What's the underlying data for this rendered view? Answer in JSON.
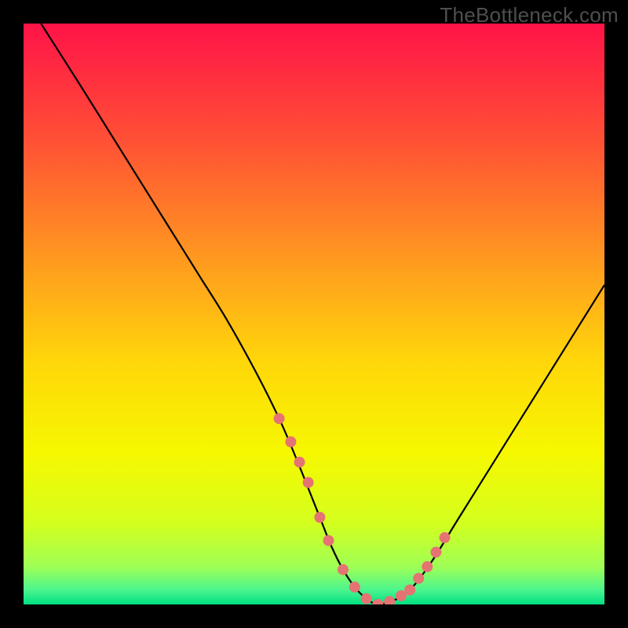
{
  "watermark": {
    "text": "TheBottleneck.com"
  },
  "chart_data": {
    "type": "line",
    "title": "",
    "xlabel": "",
    "ylabel": "",
    "xlim": [
      0,
      100
    ],
    "ylim": [
      0,
      100
    ],
    "grid": false,
    "legend": false,
    "series": [
      {
        "name": "curve",
        "x": [
          3,
          10,
          15,
          20,
          25,
          30,
          35,
          40,
          44,
          47,
          51,
          53,
          55,
          57,
          59,
          61,
          63,
          66,
          70,
          75,
          80,
          85,
          90,
          95,
          100
        ],
        "y": [
          100,
          89,
          81,
          73,
          65,
          57,
          49,
          40,
          32,
          25,
          15,
          10,
          6,
          3,
          1,
          0,
          0.5,
          2,
          7,
          15,
          23,
          31,
          39,
          47,
          55
        ]
      }
    ],
    "markers": {
      "name": "dots",
      "x": [
        44,
        46,
        47.5,
        49,
        51,
        52.5,
        55,
        57,
        59,
        61,
        63,
        65,
        66.5,
        68,
        69.5,
        71,
        72.5
      ],
      "y": [
        32,
        28,
        24.5,
        21,
        15,
        11,
        6,
        3,
        1,
        0,
        0.5,
        1.5,
        2.5,
        4.5,
        6.5,
        9,
        11.5
      ],
      "color": "#e57373",
      "radius": 7
    },
    "background_gradient": {
      "stops": [
        {
          "offset": 0.0,
          "color": "#ff1348"
        },
        {
          "offset": 0.2,
          "color": "#ff5035"
        },
        {
          "offset": 0.4,
          "color": "#ff9720"
        },
        {
          "offset": 0.58,
          "color": "#ffd60a"
        },
        {
          "offset": 0.74,
          "color": "#f6f800"
        },
        {
          "offset": 0.86,
          "color": "#d4ff1e"
        },
        {
          "offset": 0.935,
          "color": "#9fff55"
        },
        {
          "offset": 0.975,
          "color": "#4bf58e"
        },
        {
          "offset": 1.0,
          "color": "#00e083"
        }
      ]
    }
  }
}
